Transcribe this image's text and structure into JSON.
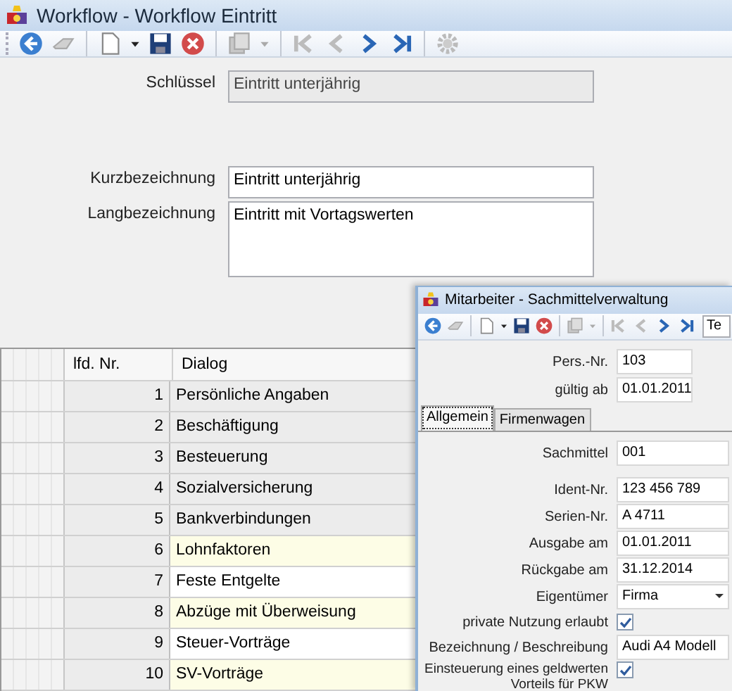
{
  "window": {
    "title": "Workflow - Workflow Eintritt"
  },
  "toolbar": [
    [
      {
        "kind": "back",
        "disabled": false
      },
      {
        "kind": "eraser",
        "disabled": true
      }
    ],
    [
      {
        "kind": "new",
        "disabled": false
      },
      {
        "kind": "caret",
        "disabled": false
      },
      {
        "kind": "save",
        "disabled": false
      },
      {
        "kind": "cancel",
        "disabled": false
      }
    ],
    [
      {
        "kind": "copy",
        "disabled": true
      },
      {
        "kind": "caret",
        "disabled": true
      }
    ],
    [
      {
        "kind": "first",
        "disabled": true
      },
      {
        "kind": "prev",
        "disabled": true
      },
      {
        "kind": "next",
        "disabled": false
      },
      {
        "kind": "last",
        "disabled": false
      }
    ],
    [
      {
        "kind": "gear",
        "disabled": true
      }
    ]
  ],
  "key_field": {
    "label": "Schlüssel",
    "value": "Eintritt unterjährig",
    "disabled": true
  },
  "fields": [
    {
      "label": "Kurzbezeichnung",
      "value": "Eintritt unterjährig",
      "kind": "text"
    },
    {
      "label": "Langbezeichnung",
      "value": "Eintritt mit Vortagswerten",
      "kind": "multiline"
    }
  ],
  "grid": {
    "columns": [
      "lfd. Nr.",
      "Dialog"
    ],
    "rows": [
      {
        "number": "1",
        "dialog": "Persönliche Angaben",
        "kind": "fixed"
      },
      {
        "number": "2",
        "dialog": "Beschäftigung",
        "kind": "fixed"
      },
      {
        "number": "3",
        "dialog": "Besteuerung",
        "kind": "fixed"
      },
      {
        "number": "4",
        "dialog": "Sozialversicherung",
        "kind": "fixed"
      },
      {
        "number": "5",
        "dialog": "Bankverbindungen",
        "kind": "fixed"
      },
      {
        "number": "6",
        "dialog": "Lohnfaktoren",
        "kind": "highlighted"
      },
      {
        "number": "7",
        "dialog": "Feste Entgelte",
        "kind": "plain"
      },
      {
        "number": "8",
        "dialog": "Abzüge mit Überweisung",
        "kind": "highlighted"
      },
      {
        "number": "9",
        "dialog": "Steuer-Vorträge",
        "kind": "plain"
      },
      {
        "number": "10",
        "dialog": "SV-Vorträge",
        "kind": "highlighted"
      }
    ]
  },
  "sub_window": {
    "title": "Mitarbeiter - Sachmittelverwaltung",
    "toolbar": [
      [
        {
          "kind": "back",
          "disabled": false
        },
        {
          "kind": "eraser",
          "disabled": true
        }
      ],
      [
        {
          "kind": "new",
          "disabled": false
        },
        {
          "kind": "caret",
          "disabled": false
        },
        {
          "kind": "save",
          "disabled": false
        },
        {
          "kind": "cancel",
          "disabled": false
        }
      ],
      [
        {
          "kind": "copy",
          "disabled": true
        },
        {
          "kind": "caret",
          "disabled": true
        }
      ],
      [
        {
          "kind": "first",
          "disabled": true
        },
        {
          "kind": "prev",
          "disabled": true
        },
        {
          "kind": "next",
          "disabled": false
        },
        {
          "kind": "last",
          "disabled": false
        }
      ]
    ],
    "toolbar_field": {
      "value": "Te"
    },
    "header_fields": [
      {
        "label": "Pers.-Nr.",
        "value": "103"
      },
      {
        "label": "gültig ab",
        "value": "01.01.2011"
      }
    ],
    "tabs": [
      {
        "label": "Allgemein",
        "selected": true
      },
      {
        "label": "Firmenwagen",
        "selected": false
      }
    ],
    "fields": [
      {
        "label": "Sachmittel",
        "value": "001",
        "kind": "text"
      },
      {
        "label": "Ident-Nr.",
        "value": "123 456 789",
        "kind": "text"
      },
      {
        "label": "Serien-Nr.",
        "value": "A 4711",
        "kind": "text"
      },
      {
        "label": "Ausgabe am",
        "value": "01.01.2011",
        "kind": "text"
      },
      {
        "label": "Rückgabe am",
        "value": "31.12.2014",
        "kind": "text"
      },
      {
        "label": "Eigentümer",
        "value": "Firma",
        "kind": "dropdown"
      },
      {
        "label": "private Nutzung erlaubt",
        "checked": true,
        "kind": "checkbox"
      },
      {
        "label": "Bezeichnung / Beschreibung",
        "value": "Audi A4 Modell",
        "kind": "text"
      },
      {
        "label": "Einsteuerung eines geldwerten Vorteils für PKW",
        "checked": true,
        "kind": "checkbox"
      }
    ]
  }
}
